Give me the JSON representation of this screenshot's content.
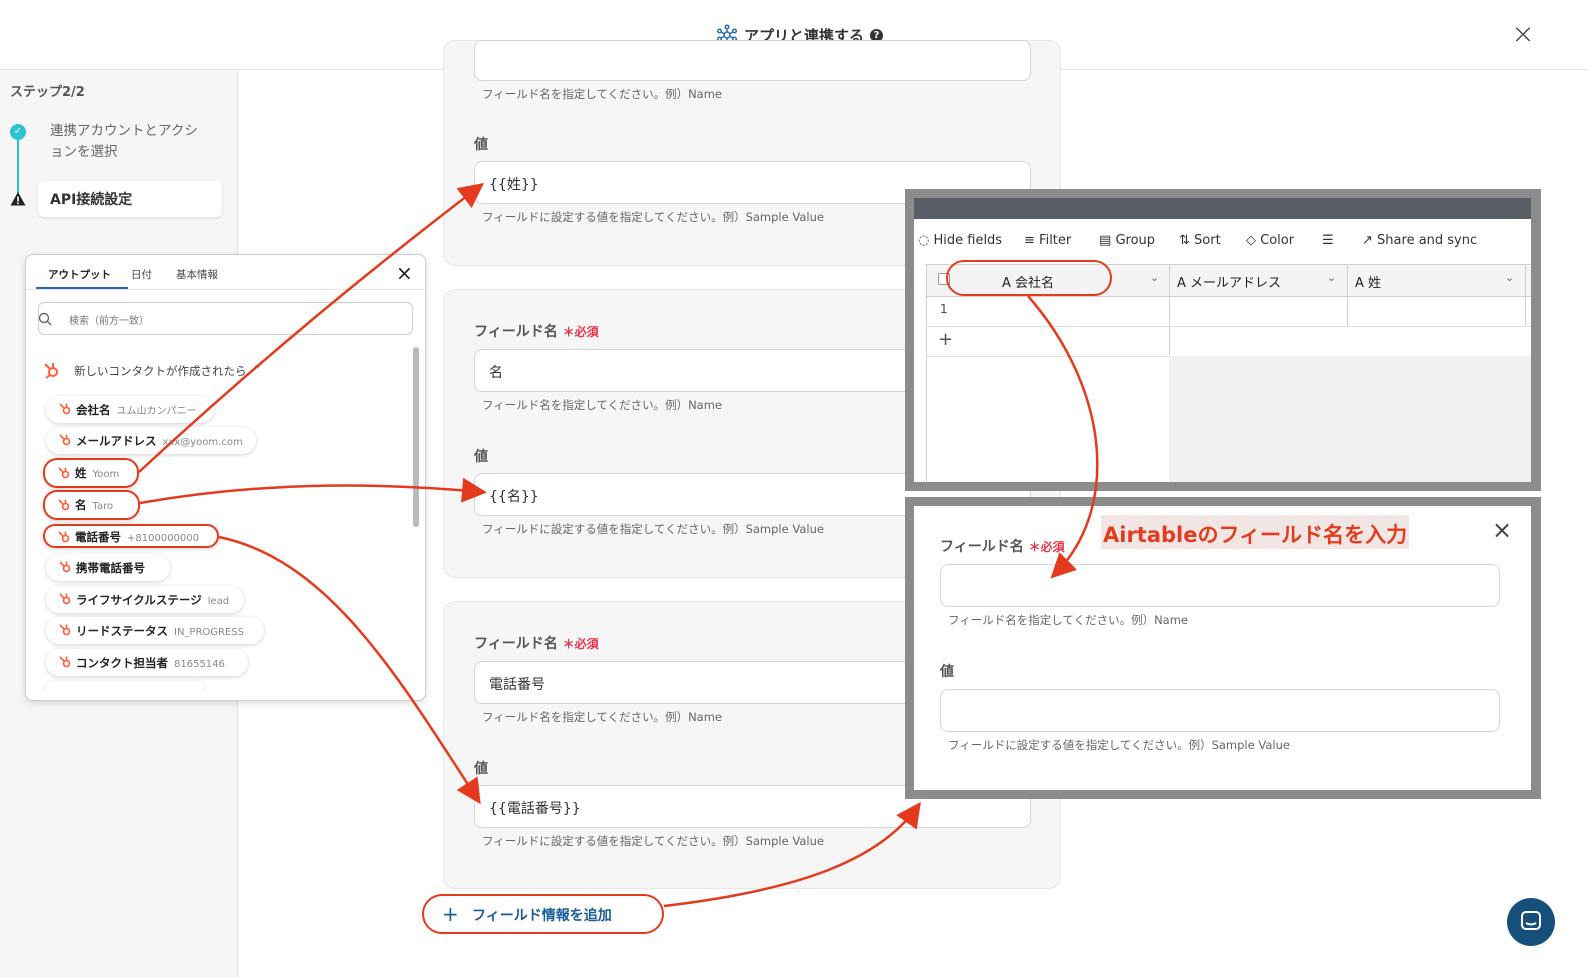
{
  "header": {
    "title": "アプリと連携する",
    "help": "?",
    "close": "×"
  },
  "sidebar": {
    "step_title": "ステップ2/2",
    "steps": [
      {
        "label": "連携アカウントとアクションを選択"
      },
      {
        "label": "API接続設定"
      }
    ]
  },
  "form": {
    "partial_hint_top": "フィールド名を指定してください。例）Name",
    "value_label": "値",
    "field_name_label": "フィールド名",
    "required": "必須",
    "field_name_hint": "フィールド名を指定してください。例）Name",
    "value_hint": "フィールドに設定する値を指定してください。例）Sample Value",
    "groups": [
      {
        "field_name": "",
        "value": "{{姓}}"
      },
      {
        "field_name": "名",
        "value": "{{名}}"
      },
      {
        "field_name": "電話番号",
        "value": "{{電話番号}}"
      }
    ],
    "add_button": "フィールド情報を追加"
  },
  "popup": {
    "tabs": [
      "アウトプット",
      "日付",
      "基本情報"
    ],
    "search_placeholder": "検索（前方一致）",
    "section": "新しいコンタクトが作成されたら",
    "items": [
      {
        "label": "会社名",
        "value": "ユム山カンパニー"
      },
      {
        "label": "メールアドレス",
        "value": "xxx@yoom.com"
      },
      {
        "label": "姓",
        "value": "Yoom"
      },
      {
        "label": "名",
        "value": "Taro"
      },
      {
        "label": "電話番号",
        "value": "+8100000000"
      },
      {
        "label": "携帯電話番号",
        "value": ""
      },
      {
        "label": "ライフサイクルステージ",
        "value": "lead"
      },
      {
        "label": "リードステータス",
        "value": "IN_PROGRESS"
      },
      {
        "label": "コンタクト担当者",
        "value": "81655146"
      }
    ],
    "close": "×"
  },
  "airtable": {
    "toolbar": [
      "Hide fields",
      "Filter",
      "Group",
      "Sort",
      "Color",
      "Share and sync"
    ],
    "columns": [
      "会社名",
      "メールアドレス",
      "姓"
    ],
    "row_number": "1",
    "add_row": "+"
  },
  "modal": {
    "banner": "Airtableのフィールド名を入力",
    "field_name_label": "フィールド名",
    "required": "必須",
    "field_name_hint": "フィールド名を指定してください。例）Name",
    "value_label": "値",
    "value_hint": "フィールドに設定する値を指定してください。例）Sample Value",
    "close": "×"
  },
  "colors": {
    "accent_red": "#e43a1e",
    "teal": "#2ec1d3",
    "link_blue": "#1a5b9a",
    "hubspot_orange": "#ff5c35"
  }
}
